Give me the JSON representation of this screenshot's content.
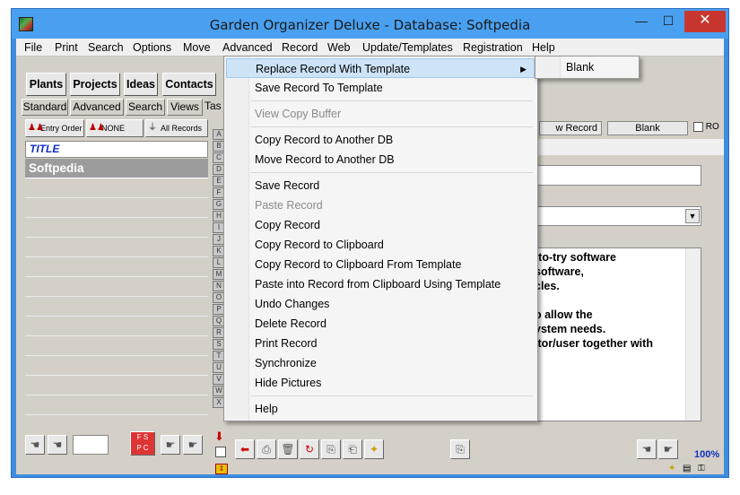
{
  "window": {
    "title": "Garden Organizer Deluxe - Database: Softpedia",
    "min_glyph": "—",
    "max_glyph": "☐",
    "close_glyph": "✕"
  },
  "menubar": [
    "File",
    "Print",
    "Search",
    "Options",
    "Move",
    "Advanced",
    "Record",
    "Web",
    "Update/Templates",
    "Registration",
    "Help"
  ],
  "toolbar": {
    "buttons": [
      "Plants",
      "Projects",
      "Ideas",
      "Contacts"
    ]
  },
  "subtabs": [
    "Standard",
    "Advanced",
    "Search",
    "Views",
    "Tas"
  ],
  "list": {
    "header_buttons": [
      "Entry Order",
      "NONE",
      "All Records"
    ],
    "column_title": "TITLE",
    "selected_row": "Softpedia"
  },
  "alphabet": [
    "A",
    "B",
    "C",
    "D",
    "E",
    "F",
    "G",
    "H",
    "I",
    "J",
    "K",
    "L",
    "M",
    "N",
    "O",
    "P",
    "Q",
    "R",
    "S",
    "T",
    "U",
    "V",
    "W",
    "X"
  ],
  "right_panel": {
    "new_record_label": "w Record",
    "blank_label": "Blank",
    "ro_label": "RO",
    "memo_lines": [
      "-to-try software",
      " software,",
      "cles.",
      "",
      "o allow the",
      "ystem needs.",
      "itor/user together with"
    ]
  },
  "status": {
    "zoom": "100%"
  },
  "record_menu": {
    "items": [
      {
        "label": "Replace Record With Template",
        "disabled": false,
        "highlighted": true,
        "submenu": true
      },
      {
        "label": "Save Record To Template",
        "disabled": false
      },
      {
        "sep": true
      },
      {
        "label": "View Copy Buffer",
        "disabled": true
      },
      {
        "sep": true
      },
      {
        "label": "Copy Record to Another DB",
        "disabled": false
      },
      {
        "label": "Move Record to Another DB",
        "disabled": false
      },
      {
        "sep": true
      },
      {
        "label": "Save Record",
        "disabled": false
      },
      {
        "label": "Paste Record",
        "disabled": true
      },
      {
        "label": "Copy Record",
        "disabled": false
      },
      {
        "label": "Copy Record to Clipboard",
        "disabled": false
      },
      {
        "label": "Copy Record to Clipboard From Template",
        "disabled": false
      },
      {
        "label": "Paste into Record from Clipboard Using Template",
        "disabled": false
      },
      {
        "label": "Undo Changes",
        "disabled": false
      },
      {
        "label": "Delete Record",
        "disabled": false
      },
      {
        "label": "Print Record",
        "disabled": false
      },
      {
        "label": "Synchronize",
        "disabled": false
      },
      {
        "label": "Hide Pictures",
        "disabled": false
      },
      {
        "sep": true
      },
      {
        "label": "Help",
        "disabled": false
      }
    ],
    "submenu_arrow": "▶"
  },
  "template_submenu": {
    "items": [
      "Blank"
    ]
  }
}
